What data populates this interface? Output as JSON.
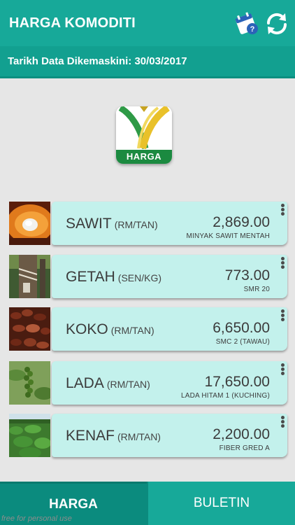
{
  "appbar": {
    "title": "HARGA KOMODITI",
    "help_icon": "help-calendar-icon",
    "refresh_icon": "refresh-icon"
  },
  "update": {
    "text": "Tarikh Data Dikemaskini: 30/03/2017"
  },
  "logo": {
    "text": "HARGA"
  },
  "commodities": [
    {
      "name": "SAWIT",
      "unit": "(RM/TAN)",
      "price": "2,869.00",
      "sub": "MINYAK SAWIT MENTAH",
      "image": "palm-fruit"
    },
    {
      "name": "GETAH",
      "unit": "(SEN/KG)",
      "price": "773.00",
      "sub": "SMR 20",
      "image": "rubber-tree"
    },
    {
      "name": "KOKO",
      "unit": "(RM/TAN)",
      "price": "6,650.00",
      "sub": "SMC 2 (TAWAU)",
      "image": "cocoa-beans"
    },
    {
      "name": "LADA",
      "unit": "(RM/TAN)",
      "price": "17,650.00",
      "sub": "LADA HITAM 1 (KUCHING)",
      "image": "pepper-plant"
    },
    {
      "name": "KENAF",
      "unit": "(RM/TAN)",
      "price": "2,200.00",
      "sub": "FIBER GRED A",
      "image": "kenaf-field"
    }
  ],
  "tabs": {
    "harga": "HARGA",
    "buletin": "BULETIN"
  },
  "watermark": "free for personal use",
  "colors": {
    "primary": "#17a999",
    "primary_dark": "#0b8b7e",
    "card": "#c3f1ec",
    "background": "#e6e6e6"
  }
}
